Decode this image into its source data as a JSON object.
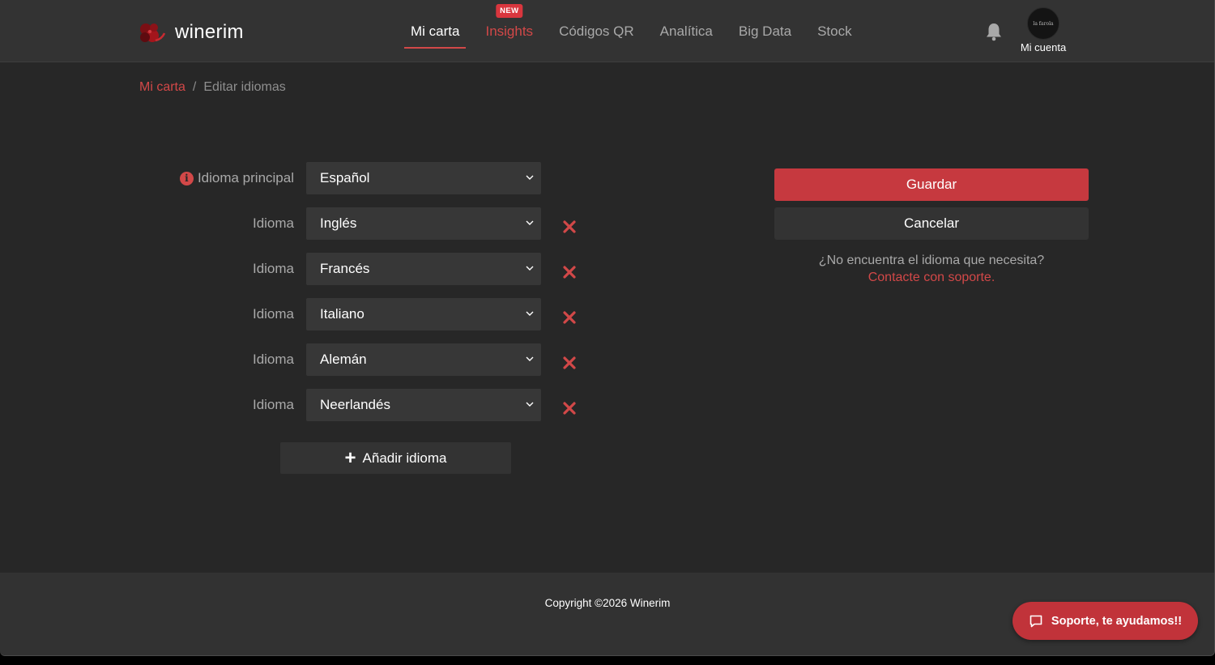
{
  "brand": {
    "name": "winerim",
    "logo_icon": "grape-logo-icon"
  },
  "nav": {
    "items": [
      {
        "label": "Mi carta",
        "active": true
      },
      {
        "label": "Insights",
        "badge": "NEW"
      },
      {
        "label": "Códigos QR"
      },
      {
        "label": "Analítica"
      },
      {
        "label": "Big Data"
      },
      {
        "label": "Stock"
      }
    ]
  },
  "header": {
    "notifications_icon": "bell-icon",
    "account": {
      "label": "Mi cuenta",
      "avatar_text": "la farola"
    }
  },
  "breadcrumb": {
    "link": "Mi carta",
    "separator": "/",
    "current": "Editar idiomas"
  },
  "form": {
    "main_language": {
      "label": "Idioma principal",
      "value": "Español"
    },
    "languages": [
      {
        "label": "Idioma",
        "value": "Inglés"
      },
      {
        "label": "Idioma",
        "value": "Francés"
      },
      {
        "label": "Idioma",
        "value": "Italiano"
      },
      {
        "label": "Idioma",
        "value": "Alemán"
      },
      {
        "label": "Idioma",
        "value": "Neerlandés"
      }
    ],
    "add_label": "Añadir idioma"
  },
  "actions": {
    "save_label": "Guardar",
    "cancel_label": "Cancelar",
    "help_question": "¿No encuentra el idioma que necesita?",
    "help_link": "Contacte con soporte."
  },
  "footer": {
    "copyright": "Copyright ©2026 Winerim"
  },
  "support": {
    "label": "Soporte, te ayudamos!!"
  },
  "colors": {
    "accent": "#d24848",
    "background": "#272727",
    "header": "#333333",
    "field": "#373737"
  }
}
